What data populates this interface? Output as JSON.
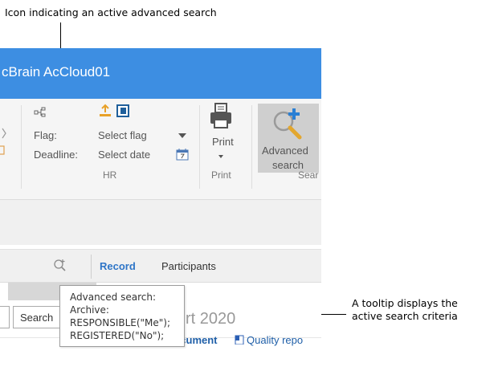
{
  "annotations": {
    "top": "Icon indicating an active advanced search",
    "right_line1": "A tooltip displays the",
    "right_line2": "active search criteria"
  },
  "window": {
    "title": "cBrain AcCloud01",
    "titlebar_color": "#3d8ee2"
  },
  "ribbon": {
    "flag_label": "Flag:",
    "flag_value": "Select flag",
    "deadline_label": "Deadline:",
    "deadline_value": "Select date",
    "group_hr": "HR",
    "print_label": "Print",
    "group_print": "Print",
    "advanced_search_line1": "Advanced",
    "advanced_search_line2": "search",
    "group_search": "Sear"
  },
  "icons": [
    "relation-icon",
    "upload-icon",
    "excel-icon",
    "dropdown-arrow-icon",
    "calendar-icon",
    "printer-icon",
    "advanced-search-icon",
    "search-active-icon",
    "word-icon"
  ],
  "tabs": {
    "record": "Record",
    "participants": "Participants",
    "active_color": "#2e75c7"
  },
  "content": {
    "search_button": "Search",
    "heading_fragment": "rt 2020",
    "doc_link_1": "Record document",
    "doc_link_2": "Quality repo"
  },
  "tooltip": {
    "lines": [
      "Advanced search:",
      "Archive:",
      "RESPONSIBLE(\"Me\");",
      "REGISTERED(\"No\");"
    ]
  }
}
